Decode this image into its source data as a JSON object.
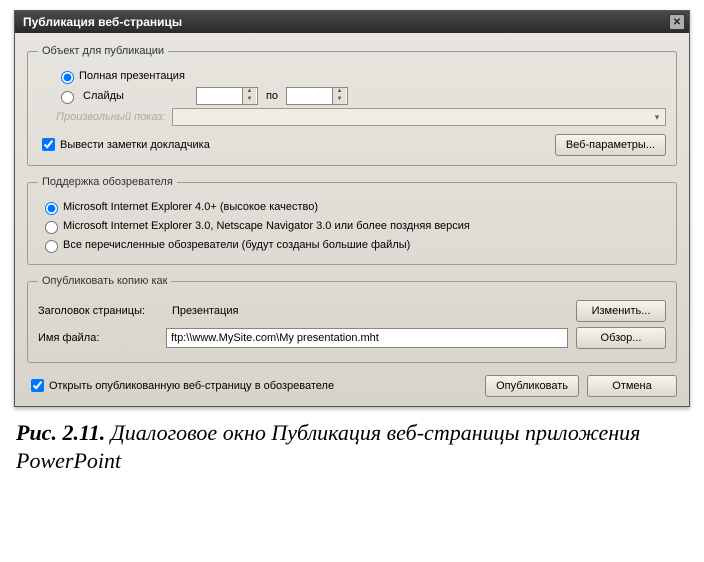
{
  "title": "Публикация веб-страницы",
  "group_object": {
    "legend": "Объект для публикации",
    "radio_full": "Полная презентация",
    "radio_slides": "Слайды",
    "slides_from": "",
    "slides_sep": "по",
    "slides_to": "",
    "custom_show_disabled": "Произвольный показ:",
    "check_notes": "Вывести заметки докладчика",
    "btn_web_options": "Веб-параметры..."
  },
  "group_browser": {
    "legend": "Поддержка обозревателя",
    "radio_ie4": "Microsoft Internet Explorer 4.0+ (высокое качество)",
    "radio_ie3": "Microsoft Internet Explorer 3.0, Netscape Navigator 3.0 или более поздняя версия",
    "radio_all": "Все перечисленные обозреватели (будут созданы большие файлы)"
  },
  "group_copy": {
    "legend": "Опубликовать копию как",
    "label_page_title": "Заголовок страницы:",
    "value_page_title": "Презентация",
    "btn_change": "Изменить...",
    "label_filename": "Имя файла:",
    "value_filename": "ftp:\\\\www.MySite.com\\My presentation.mht",
    "btn_browse": "Обзор..."
  },
  "footer": {
    "check_open": "Открыть опубликованную веб-страницу в обозревателе",
    "btn_publish": "Опубликовать",
    "btn_cancel": "Отмена"
  },
  "caption": {
    "fig": "Рис. 2.11.",
    "text": " Диалоговое окно Публикация веб-страницы приложения PowerPoint"
  }
}
